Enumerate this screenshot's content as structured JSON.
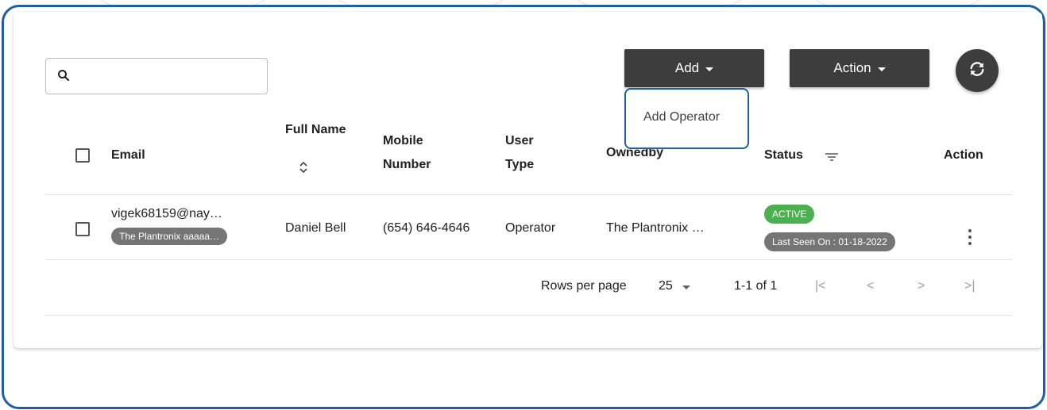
{
  "search": {
    "value": "",
    "placeholder": ""
  },
  "toolbar": {
    "add_label": "Add",
    "action_label": "Action",
    "refresh_icon": "refresh-icon"
  },
  "add_menu": {
    "items": [
      "Add Operator"
    ]
  },
  "table": {
    "columns": {
      "email": "Email",
      "full_name": "Full Name",
      "mobile_1": "Mobile",
      "mobile_2": "Number",
      "user_type_1": "User",
      "user_type_2": "Type",
      "ownedby": "Ownedby",
      "status": "Status",
      "action": "Action"
    },
    "rows": [
      {
        "email": "vigek68159@nay…",
        "owner_chip": "The Plantronix aaaaa…",
        "full_name": "Daniel Bell",
        "mobile": "(654) 646-4646",
        "user_type": "Operator",
        "ownedby": "The Plantronix …",
        "status": "ACTIVE",
        "last_seen": "Last Seen On : 01-18-2022"
      }
    ]
  },
  "pagination": {
    "rows_per_page_label": "Rows per page",
    "rows_per_page_value": "25",
    "range": "1-1 of 1"
  },
  "colors": {
    "frame_border": "#1f5f9f",
    "dark_button": "#3d3d3d",
    "active_chip": "#4caf50",
    "grey_chip": "#757575"
  }
}
